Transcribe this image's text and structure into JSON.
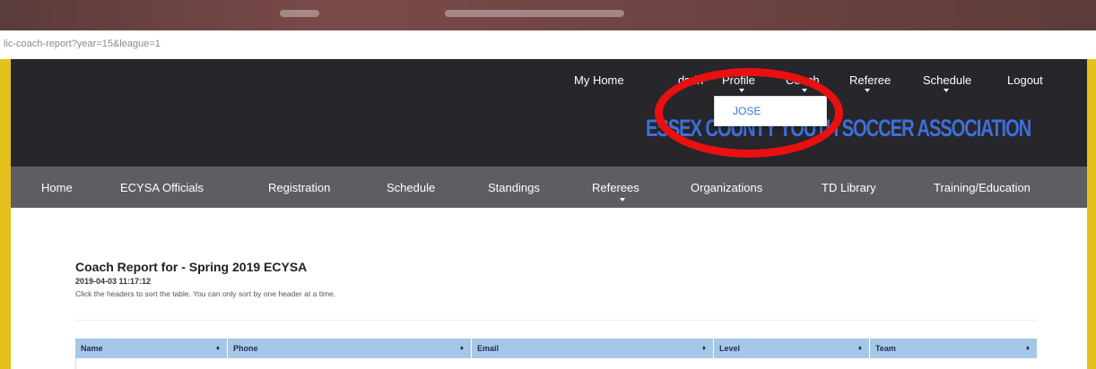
{
  "browser": {
    "url": "lic-coach-report?year=15&league=1"
  },
  "top_nav": {
    "items": [
      {
        "label": "My Home"
      },
      {
        "label": "dmin"
      },
      {
        "label": "Profile"
      },
      {
        "label": "Coach"
      },
      {
        "label": "Referee"
      },
      {
        "label": "Schedule"
      },
      {
        "label": "Logout"
      }
    ],
    "profile_dropdown": {
      "items": [
        "JOSE"
      ]
    }
  },
  "logo": {
    "text": "ESSEX COUNTY YOUTH SOCCER ASSOCIATION"
  },
  "main_nav": {
    "items": [
      "Home",
      "ECYSA Officials",
      "Registration",
      "Schedule",
      "Standings",
      "Referees",
      "Organizations",
      "TD Library",
      "Training/Education"
    ]
  },
  "report": {
    "title": "Coach Report for - Spring 2019 ECYSA",
    "date": "2019-04-03 11:17:12",
    "help": "Click the headers to sort the table. You can only sort by one header at a time.",
    "columns": [
      "Name",
      "Phone",
      "Email",
      "Level",
      "Team"
    ],
    "sort_glyph": "♦"
  },
  "colors": {
    "header_bg": "#26262b",
    "nav_bg": "#5e5e62",
    "accent": "#3f6fd8",
    "table_header": "#a7c7e7",
    "annotation": "#e81010",
    "side_bar": "#e4c11d"
  }
}
